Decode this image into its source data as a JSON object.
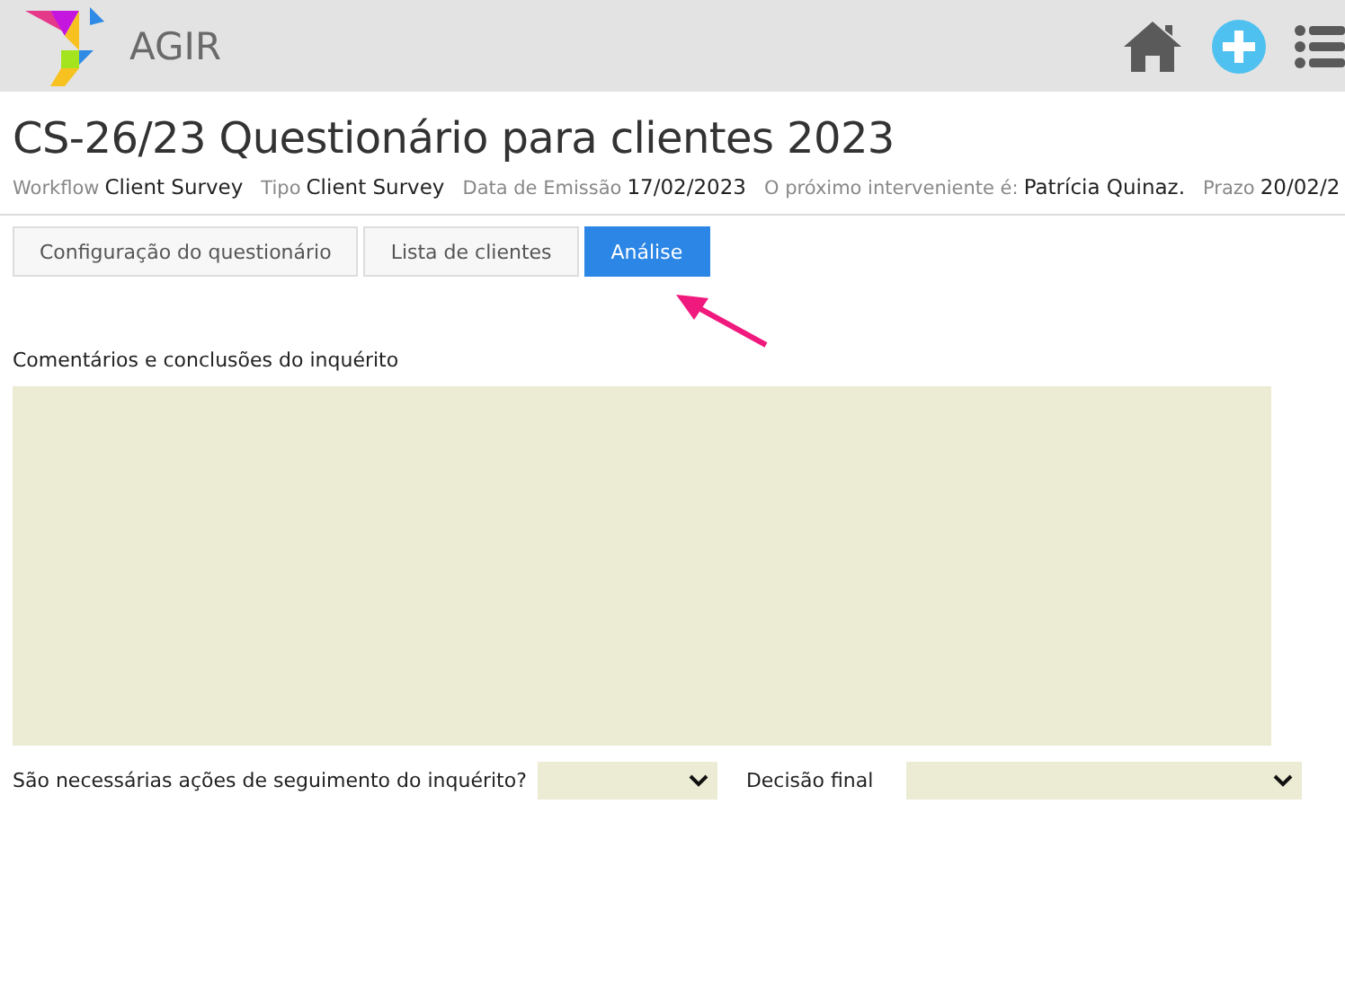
{
  "app": {
    "name": "AGIR"
  },
  "header": {
    "title": "CS-26/23 Questionário para clientes 2023",
    "meta": [
      {
        "label": "Workflow",
        "value": "Client Survey"
      },
      {
        "label": "Tipo",
        "value": "Client Survey"
      },
      {
        "label": "Data de Emissão",
        "value": "17/02/2023"
      },
      {
        "label": "O próximo interveniente é:",
        "value": "Patrícia Quinaz."
      },
      {
        "label": "Prazo",
        "value": "20/02/2"
      }
    ]
  },
  "tabs": [
    {
      "label": "Configuração do questionário",
      "selected": false
    },
    {
      "label": "Lista de clientes",
      "selected": false
    },
    {
      "label": "Análise",
      "selected": true
    }
  ],
  "comments": {
    "label": "Comentários e conclusões do inquérito"
  },
  "fields": [
    {
      "label": "São necessárias ações de seguimento do inquérito?",
      "kind": "narrow"
    },
    {
      "label": "Decisão final",
      "kind": "wide"
    }
  ]
}
